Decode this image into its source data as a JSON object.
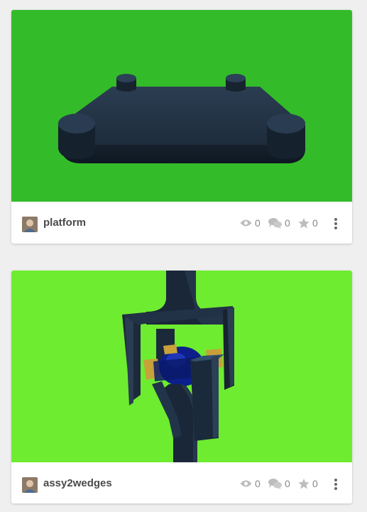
{
  "colors": {
    "page_bg": "#efefef",
    "thumb1_bg": "#34bb29",
    "thumb2_bg": "#6eec30",
    "model_dark": "#1b2a3a",
    "stat_gray": "#888888"
  },
  "cards": [
    {
      "title": "platform",
      "views": "0",
      "comments": "0",
      "stars": "0",
      "icons": [
        "avatar",
        "eye-icon",
        "comments-icon",
        "star-icon",
        "more-vertical-icon"
      ]
    },
    {
      "title": "assy2wedges",
      "views": "0",
      "comments": "0",
      "stars": "0",
      "icons": [
        "avatar",
        "eye-icon",
        "comments-icon",
        "star-icon",
        "more-vertical-icon"
      ]
    }
  ]
}
